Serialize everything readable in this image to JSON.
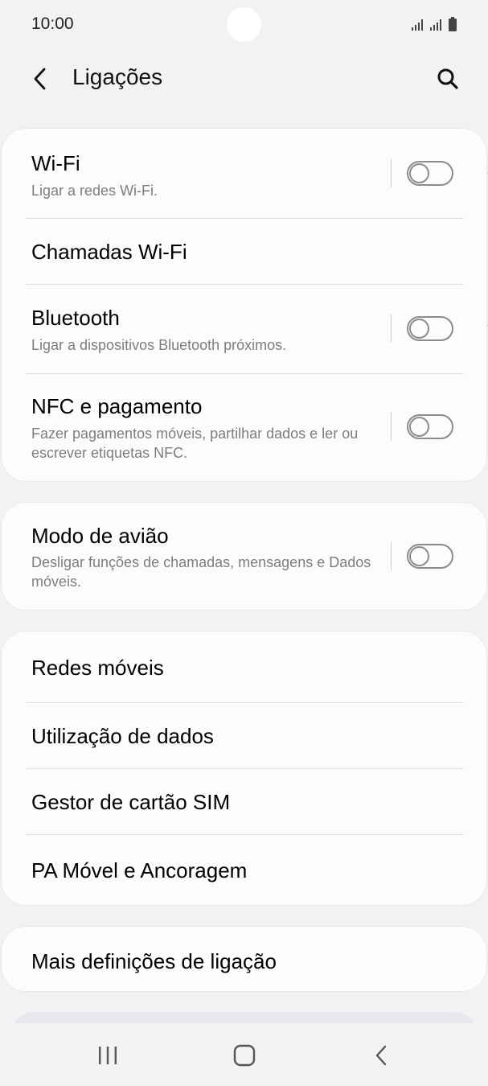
{
  "status_bar": {
    "time": "10:00",
    "icons": [
      "signal-icon",
      "signal-icon",
      "battery-icon"
    ]
  },
  "app_bar": {
    "title": "Ligações",
    "icons": [
      "back-arrow-icon",
      "search-icon"
    ]
  },
  "cards": [
    {
      "items": [
        {
          "title": "Wi-Fi",
          "subtitle": "Ligar a redes Wi-Fi.",
          "toggle": false
        },
        {
          "title": "Chamadas Wi-Fi"
        },
        {
          "title": "Bluetooth",
          "subtitle": "Ligar a dispositivos Bluetooth próximos.",
          "toggle": false
        },
        {
          "title": "NFC e pagamento",
          "subtitle": "Fazer pagamentos móveis, partilhar dados e ler ou escrever etiquetas NFC.",
          "toggle": false
        }
      ]
    },
    {
      "items": [
        {
          "title": "Modo de avião",
          "subtitle": "Desligar funções de chamadas, mensagens e Dados móveis.",
          "toggle": false
        }
      ]
    },
    {
      "items": [
        {
          "title": "Redes móveis"
        },
        {
          "title": "Utilização de dados"
        },
        {
          "title": "Gestor de cartão SIM"
        },
        {
          "title": "PA Móvel e Ancoragem"
        }
      ]
    },
    {
      "items": [
        {
          "title": "Mais definições de ligação"
        }
      ]
    }
  ],
  "nav_bar": {
    "icons": [
      "recents-icon",
      "home-icon",
      "back-icon"
    ]
  },
  "colors": {
    "background": "#f2f2f2",
    "card": "#fcfcfc",
    "subtitle": "#7d7d7d",
    "toggle_off": "#8c8c8c"
  }
}
